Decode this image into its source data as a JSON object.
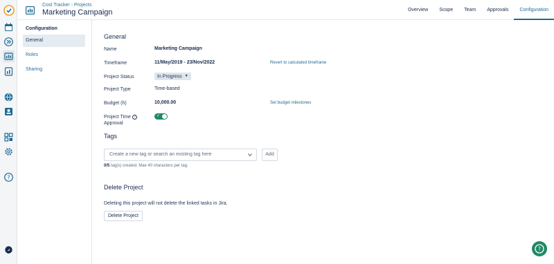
{
  "breadcrumb": {
    "root": "Cost Tracker",
    "current": "Projects"
  },
  "header": {
    "title": "Marketing Campaign"
  },
  "tabs": [
    {
      "label": "Overview",
      "active": false
    },
    {
      "label": "Scope",
      "active": false
    },
    {
      "label": "Team",
      "active": false
    },
    {
      "label": "Approvals",
      "active": false
    },
    {
      "label": "Configuration",
      "active": true
    }
  ],
  "sidebar": {
    "title": "Configuration",
    "items": [
      {
        "label": "General",
        "active": true
      },
      {
        "label": "Roles",
        "active": false
      },
      {
        "label": "Sharing",
        "active": false
      }
    ]
  },
  "general": {
    "heading": "General",
    "name_label": "Name",
    "name_value": "Marketing Campaign",
    "timeframe_label": "Timeframe",
    "timeframe_value": "11/May/2019 - 23/Nov/2022",
    "timeframe_link": "Revert to calculated timeframe",
    "status_label": "Project Status",
    "status_value": "In Progress",
    "type_label": "Project Type",
    "type_value": "Time-based",
    "budget_label": "Budget (h)",
    "budget_value": "10,000.00",
    "budget_link": "Set budget milestones",
    "approval_label_1": "Project Time",
    "approval_label_2": "Approval",
    "approval_enabled": true
  },
  "tags": {
    "heading": "Tags",
    "placeholder": "Create a new tag or search an existing tag here",
    "add_label": "Add",
    "count": "0/5",
    "hint": "tag(s) created. Max 40 characters per tag."
  },
  "delete": {
    "heading": "Delete Project",
    "description": "Deleting this project will not delete the linked tasks in Jira.",
    "button_label": "Delete Project"
  },
  "colors": {
    "accent": "#1e6b94",
    "success": "#1e8a66",
    "rail": "#f4f5f7"
  },
  "rail_icons": [
    "app-logo-icon",
    "calendar-icon",
    "forward-icon",
    "projects-icon",
    "reports-icon",
    "globe-icon",
    "portfolio-icon",
    "apps-icon",
    "settings-icon",
    "help-icon",
    "rocket-icon"
  ]
}
